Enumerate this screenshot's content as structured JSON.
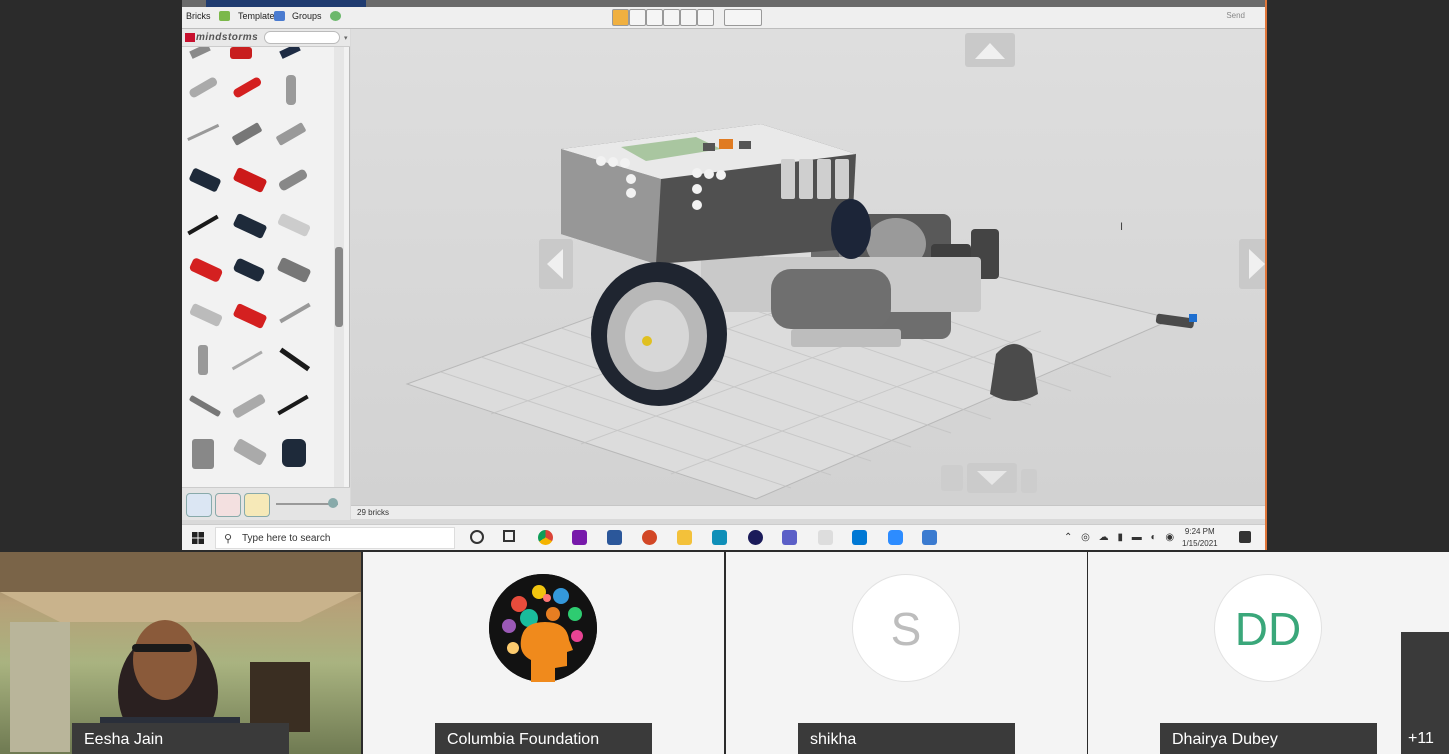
{
  "ldd": {
    "tabs": {
      "bricks": "Bricks",
      "templates": "Templates",
      "groups": "Groups"
    },
    "send_label": "Send",
    "brand": "mindstorms",
    "status_text": "29 bricks",
    "model_alt": "robot-model"
  },
  "taskbar": {
    "search_placeholder": "Type here to search",
    "time": "9:24 PM",
    "date": "1/15/2021"
  },
  "participants": [
    {
      "name": "Eesha Jain"
    },
    {
      "name": "Columbia Foundation"
    },
    {
      "name": "shikha",
      "initials": "S",
      "color": "#bdbdbd"
    },
    {
      "name": "Dhairya Dubey",
      "initials": "DD",
      "color": "#3aa77a"
    }
  ],
  "more_count": "+11"
}
